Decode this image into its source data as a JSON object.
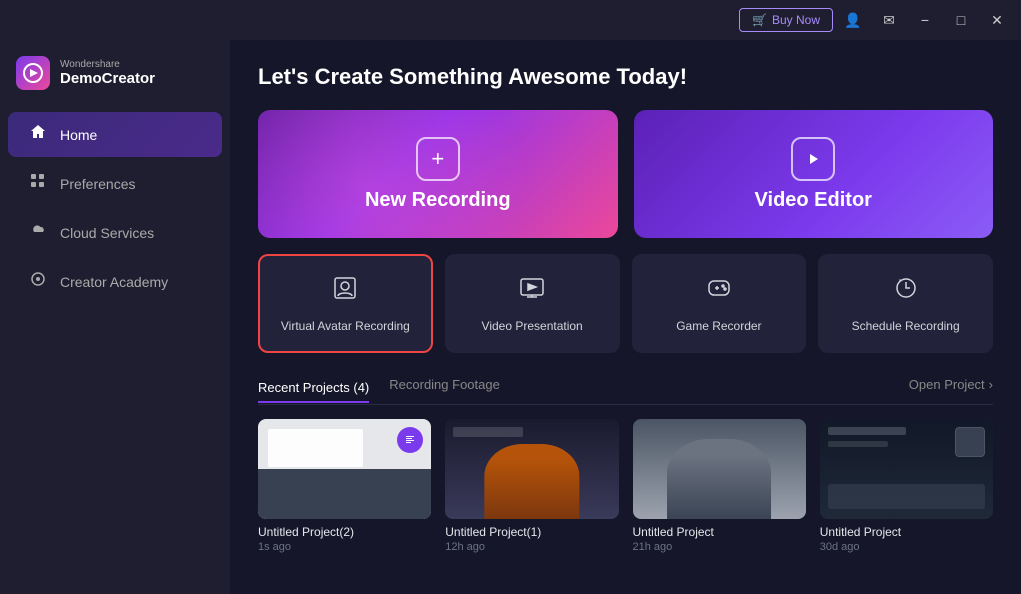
{
  "titlebar": {
    "buy_now_label": "Buy Now",
    "minimize_label": "−",
    "maximize_label": "□",
    "close_label": "✕",
    "cart_icon": "🛒",
    "user_icon": "👤",
    "mail_icon": "✉"
  },
  "sidebar": {
    "logo": {
      "brand_small": "Wondershare",
      "brand_main": "DemoCreator",
      "icon_letter": "D"
    },
    "items": [
      {
        "id": "home",
        "label": "Home",
        "icon": "⌂",
        "active": true
      },
      {
        "id": "preferences",
        "label": "Preferences",
        "icon": "⊞"
      },
      {
        "id": "cloud-services",
        "label": "Cloud Services",
        "icon": "☁"
      },
      {
        "id": "creator-academy",
        "label": "Creator Academy",
        "icon": "◎"
      }
    ]
  },
  "main": {
    "heading": "Let's Create Something Awesome Today!",
    "action_cards": [
      {
        "id": "new-recording",
        "label": "New Recording",
        "icon": "+"
      },
      {
        "id": "video-editor",
        "label": "Video Editor",
        "icon": "▶"
      }
    ],
    "sub_cards": [
      {
        "id": "virtual-avatar",
        "label": "Virtual Avatar Recording",
        "icon": "⊡",
        "selected": true
      },
      {
        "id": "video-presentation",
        "label": "Video Presentation",
        "icon": "⊟"
      },
      {
        "id": "game-recorder",
        "label": "Game Recorder",
        "icon": "⊞"
      },
      {
        "id": "schedule-recording",
        "label": "Schedule Recording",
        "icon": "⊙"
      }
    ],
    "tabs": [
      {
        "id": "recent-projects",
        "label": "Recent Projects (4)",
        "active": true
      },
      {
        "id": "recording-footage",
        "label": "Recording Footage",
        "active": false
      }
    ],
    "open_project_label": "Open Project",
    "open_project_arrow": "›",
    "projects": [
      {
        "id": 1,
        "name": "Untitled Project(2)",
        "time": "1s ago",
        "thumb_type": "1"
      },
      {
        "id": 2,
        "name": "Untitled Project(1)",
        "time": "12h ago",
        "thumb_type": "2"
      },
      {
        "id": 3,
        "name": "Untitled Project",
        "time": "21h ago",
        "thumb_type": "3"
      },
      {
        "id": 4,
        "name": "Untitled Project",
        "time": "30d ago",
        "thumb_type": "4"
      }
    ]
  }
}
